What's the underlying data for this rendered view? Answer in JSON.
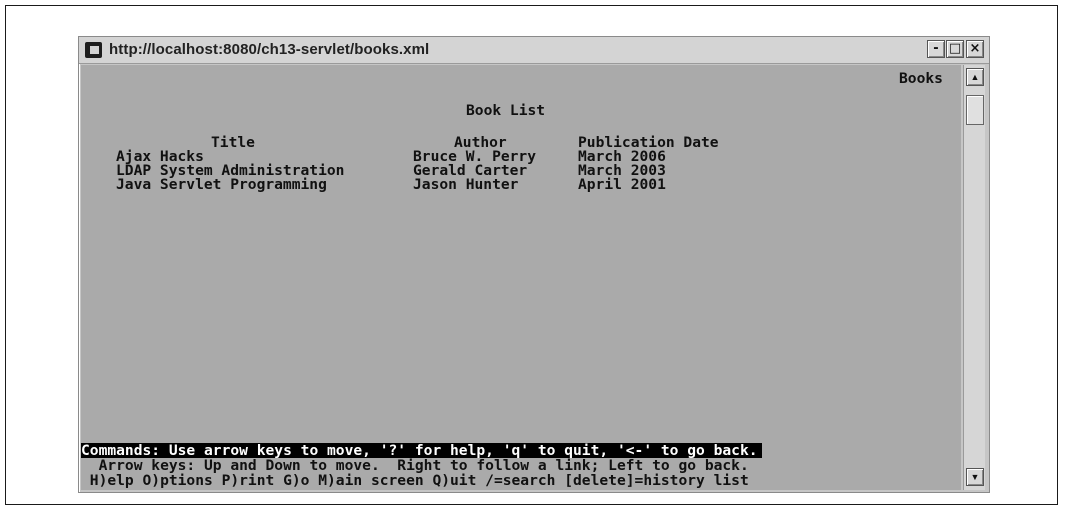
{
  "window": {
    "title": "http://localhost:8080/ch13-servlet/books.xml",
    "buttons": {
      "minimize": "-",
      "maximize": "□",
      "close": "×"
    }
  },
  "terminal": {
    "top_right_label": "Books",
    "heading": "Book List",
    "columns": {
      "title": "Title",
      "author": "Author",
      "date": "Publication Date"
    },
    "rows": [
      {
        "title": "Ajax Hacks",
        "author": "Bruce W. Perry",
        "date": "March 2006"
      },
      {
        "title": "LDAP System Administration",
        "author": "Gerald Carter",
        "date": "March 2003"
      },
      {
        "title": "Java Servlet Programming",
        "author": "Jason Hunter",
        "date": "April 2001"
      }
    ],
    "status_line": "Commands: Use arrow keys to move, '?' for help, 'q' to quit, '<-' to go back.",
    "help_line_1": "  Arrow keys: Up and Down to move.  Right to follow a link; Left to go back.",
    "help_line_2": " H)elp O)ptions P)rint G)o M)ain screen Q)uit /=search [delete]=history list"
  },
  "scrollbar": {
    "up_arrow": "▲",
    "down_arrow": "▼"
  }
}
